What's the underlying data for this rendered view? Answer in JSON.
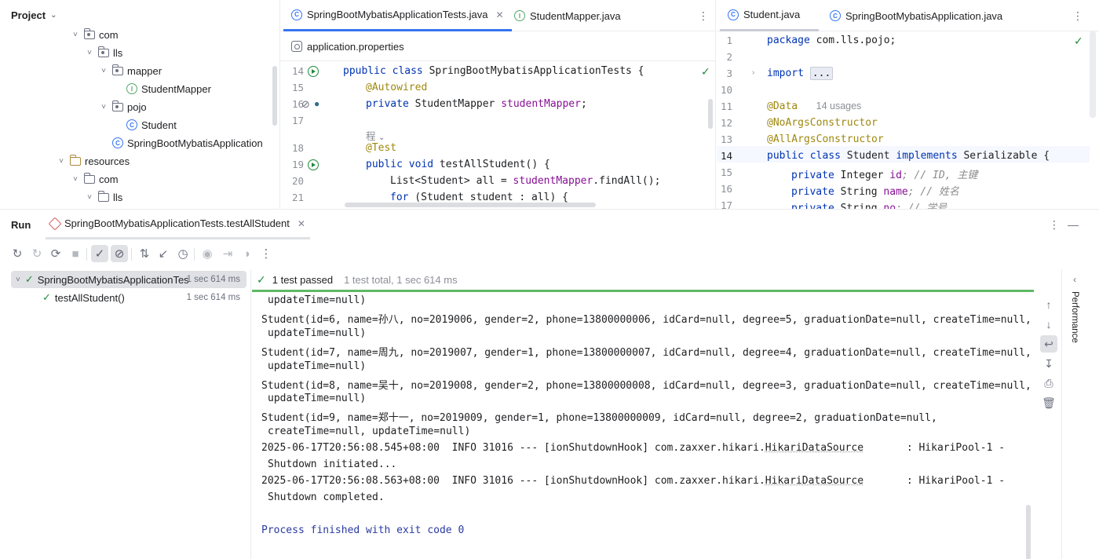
{
  "project": {
    "title": "Project",
    "tree": [
      {
        "label": "com",
        "kind": "package",
        "indent": 0,
        "expanded": true
      },
      {
        "label": "lls",
        "kind": "package",
        "indent": 1,
        "expanded": true
      },
      {
        "label": "mapper",
        "kind": "package",
        "indent": 2,
        "expanded": true
      },
      {
        "label": "StudentMapper",
        "kind": "interface",
        "indent": 3
      },
      {
        "label": "pojo",
        "kind": "package",
        "indent": 2,
        "expanded": true
      },
      {
        "label": "Student",
        "kind": "class",
        "indent": 3
      },
      {
        "label": "SpringBootMybatisApplication",
        "kind": "boot",
        "indent": 2
      },
      {
        "label": "resources",
        "kind": "resources",
        "indent": -1,
        "expanded": true
      },
      {
        "label": "com",
        "kind": "folder",
        "indent": 0,
        "expanded": true
      },
      {
        "label": "lls",
        "kind": "folder",
        "indent": 1,
        "expanded": true
      }
    ]
  },
  "editor1": {
    "tabs": [
      {
        "label": "SpringBootMybatisApplicationTests.java",
        "active": true
      },
      {
        "label": "StudentMapper.java",
        "active": false
      }
    ],
    "second_tab": "application.properties",
    "lines": [
      {
        "num": "14",
        "html_key": "l14"
      },
      {
        "num": "15",
        "html_key": "l15"
      },
      {
        "num": "16",
        "html_key": "l16"
      },
      {
        "num": "17",
        "html_key": "l17"
      },
      {
        "num": "",
        "html_key": "lhint"
      },
      {
        "num": "18",
        "html_key": "l18"
      },
      {
        "num": "19",
        "html_key": "l19"
      },
      {
        "num": "20",
        "html_key": "l20"
      },
      {
        "num": "21",
        "html_key": "l21"
      }
    ],
    "code": {
      "l14_kw": "public class",
      "l14_rest": " SpringBootMybatisApplicationTests {",
      "l14_prefix": "p",
      "l15": "@Autowired",
      "l16_kw": "private",
      "l16_type": " StudentMapper ",
      "l16_field": "studentMapper",
      "l16_end": ";",
      "hint": "程",
      "l18": "@Test",
      "l19_kw": "public void",
      "l19_rest": " testAllStudent() {",
      "l20_a": "List<Student> all = ",
      "l20_field": "studentMapper",
      "l20_b": ".findAll();",
      "l21_kw": "for",
      "l21_rest": " (Student student : all) {"
    }
  },
  "editor2": {
    "tabs": [
      {
        "label": "Student.java",
        "active": true
      },
      {
        "label": "SpringBootMybatisApplication.java",
        "active": false
      }
    ],
    "code": {
      "n1": "1",
      "n2": "2",
      "n3": "3",
      "n10": "10",
      "n11": "11",
      "n12": "12",
      "n13": "13",
      "n14": "14",
      "n15": "15",
      "n16": "16",
      "n17": "17",
      "pkg_kw": "package",
      "pkg_rest": " com.lls.pojo;",
      "imp_kw": "import",
      "imp_fold": "...",
      "data_ann": "@Data",
      "data_usages": "14 usages",
      "noargs": "@NoArgsConstructor",
      "allargs": "@AllArgsConstructor",
      "cls_kw": "public class",
      "cls_name": " Student ",
      "cls_impl": "implements",
      "cls_iface": " Serializable {",
      "f1_kw": "private",
      "f1_rest": " Integer ",
      "f1_name": "id",
      "f1_cmt": "; // ID, 主键",
      "f2_kw": "private",
      "f2_rest": " String ",
      "f2_name": "name",
      "f2_cmt": "; // 姓名",
      "f3_kw": "private",
      "f3_rest": " String ",
      "f3_name": "no",
      "f3_cmt": "; // 学号"
    }
  },
  "run": {
    "title": "Run",
    "tab_label": "SpringBootMybatisApplicationTests.testAllStudent",
    "tree": [
      {
        "label": "SpringBootMybatisApplicationTes",
        "time": "1 sec 614 ms",
        "selected": true,
        "indent": 0
      },
      {
        "label": "testAllStudent()",
        "time": "1 sec 614 ms",
        "selected": false,
        "indent": 1
      }
    ],
    "status_passed": "1 test passed",
    "status_total": "1 test total, 1 sec 614 ms",
    "progress_fraction": 1.0,
    "output": [
      {
        "text": "updateTime=null)",
        "cont": true
      },
      {
        "text": "Student(id=6, name=孙八, no=2019006, gender=2, phone=13800000006, idCard=null, degree=5, graduationDate=null, createTime=null,",
        "cont": false
      },
      {
        "text": "updateTime=null)",
        "cont": true
      },
      {
        "text": "Student(id=7, name=周九, no=2019007, gender=1, phone=13800000007, idCard=null, degree=4, graduationDate=null, createTime=null,",
        "cont": false
      },
      {
        "text": "updateTime=null)",
        "cont": true
      },
      {
        "text": "Student(id=8, name=吴十, no=2019008, gender=2, phone=13800000008, idCard=null, degree=3, graduationDate=null, createTime=null,",
        "cont": false
      },
      {
        "text": "updateTime=null)",
        "cont": true
      },
      {
        "text": "Student(id=9, name=郑十一, no=2019009, gender=1, phone=13800000009, idCard=null, degree=2, graduationDate=null,",
        "cont": false
      },
      {
        "text": "createTime=null, updateTime=null)",
        "cont": true
      },
      {
        "text": "2025-06-17T20:56:08.545+08:00  INFO 31016 --- [ionShutdownHook] com.zaxxer.hikari.HikariDataSource       : HikariPool-1 -",
        "cont": false
      },
      {
        "text": "Shutdown initiated...",
        "cont": true
      },
      {
        "text": "2025-06-17T20:56:08.563+08:00  INFO 31016 --- [ionShutdownHook] com.zaxxer.hikari.HikariDataSource       : HikariPool-1 -",
        "cont": false
      },
      {
        "text": "Shutdown completed.",
        "cont": true
      },
      {
        "text": "",
        "cont": false
      },
      {
        "text": "Process finished with exit code 0",
        "cont": false,
        "done": true
      }
    ],
    "side_label": "Performance"
  }
}
